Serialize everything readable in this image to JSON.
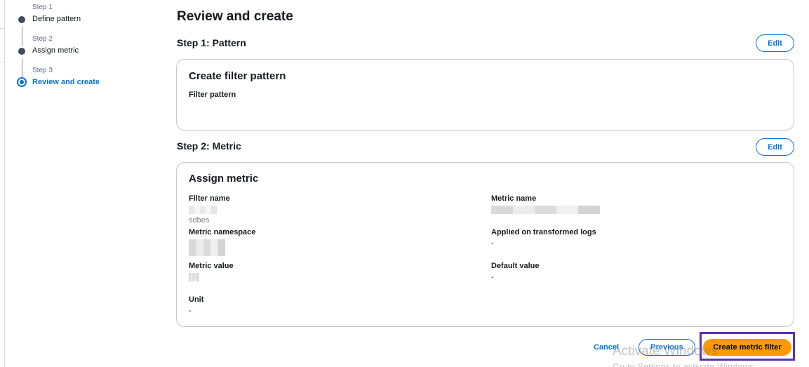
{
  "wizard": {
    "steps": [
      {
        "sub": "Step 1",
        "title": "Define pattern"
      },
      {
        "sub": "Step 2",
        "title": "Assign metric"
      },
      {
        "sub": "Step 3",
        "title": "Review and create"
      }
    ],
    "active_step": 3
  },
  "page": {
    "title": "Review and create"
  },
  "step1": {
    "heading": "Step 1: Pattern",
    "edit_label": "Edit",
    "card_title": "Create filter pattern",
    "filter_pattern_label": "Filter pattern",
    "filter_pattern_value": ""
  },
  "step2": {
    "heading": "Step 2: Metric",
    "edit_label": "Edit",
    "card_title": "Assign metric",
    "filter_name_label": "Filter name",
    "filter_name_value": "sdbes",
    "metric_name_label": "Metric name",
    "metric_namespace_label": "Metric namespace",
    "applied_label": "Applied on transformed logs",
    "applied_value": "-",
    "metric_value_label": "Metric value",
    "default_value_label": "Default value",
    "default_value_value": "-",
    "unit_label": "Unit",
    "unit_value": "-"
  },
  "footer": {
    "cancel_label": "Cancel",
    "previous_label": "Previous",
    "create_label": "Create metric filter"
  },
  "watermark": {
    "line1": "Activate Windows",
    "line2": "Go to Settings to activate Windows."
  },
  "colors": {
    "accent": "#0972d3",
    "primary_button": "#ff9900",
    "highlight_box": "#5b2fb8"
  }
}
